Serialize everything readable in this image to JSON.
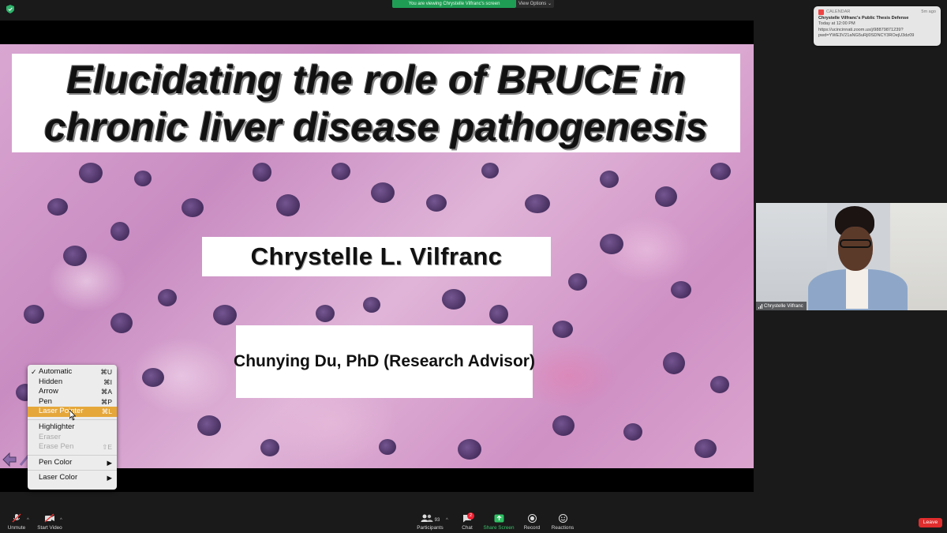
{
  "banner": {
    "viewing_text": "You are viewing Chrystelle Vilfranc's screen",
    "view_options_label": "View Options",
    "color": "#1f9d55"
  },
  "notification": {
    "app": "CALENDAR",
    "time_ago": "5m ago",
    "title": "Chrystelle Vilfranc's Public Thesis Defense",
    "when": "Today at 12:00 PM",
    "link_line1": "https://ucincinnati.zoom.us/j/98879871239?",
    "link_line2": "pwd=YWE3V21aNG5uRjl0SDNCY3ROejU3dz09"
  },
  "slide": {
    "title_line1": "Elucidating the role of BRUCE in",
    "title_line2": "chronic liver disease pathogenesis",
    "presenter": "Chrystelle L. Vilfranc",
    "advisor": "Chunying Du, PhD (Research Advisor)"
  },
  "annotate_menu": {
    "items": [
      {
        "label": "Automatic",
        "shortcut": "⌘U",
        "checked": true,
        "state": "normal"
      },
      {
        "label": "Hidden",
        "shortcut": "⌘I",
        "state": "normal"
      },
      {
        "label": "Arrow",
        "shortcut": "⌘A",
        "state": "normal"
      },
      {
        "label": "Pen",
        "shortcut": "⌘P",
        "state": "normal"
      },
      {
        "label": "Laser Pointer",
        "shortcut": "⌘L",
        "state": "selected"
      }
    ],
    "items2": [
      {
        "label": "Highlighter",
        "shortcut": "",
        "state": "normal"
      },
      {
        "label": "Eraser",
        "shortcut": "",
        "state": "disabled"
      },
      {
        "label": "Erase Pen",
        "shortcut": "⇧E",
        "state": "disabled"
      }
    ],
    "submenus": [
      {
        "label": "Pen Color",
        "arrow": "▶"
      },
      {
        "label": "Laser Color",
        "arrow": "▶"
      }
    ],
    "highlight_color": "#e5a73a"
  },
  "video": {
    "participant_name": "Chrystelle Vilfranc"
  },
  "toolbar": {
    "unmute": "Unmute",
    "start_video": "Start Video",
    "participants": "Participants",
    "participants_count": "93",
    "chat": "Chat",
    "chat_badge": "2",
    "share_screen": "Share Screen",
    "record": "Record",
    "reactions": "Reactions",
    "leave": "Leave"
  }
}
